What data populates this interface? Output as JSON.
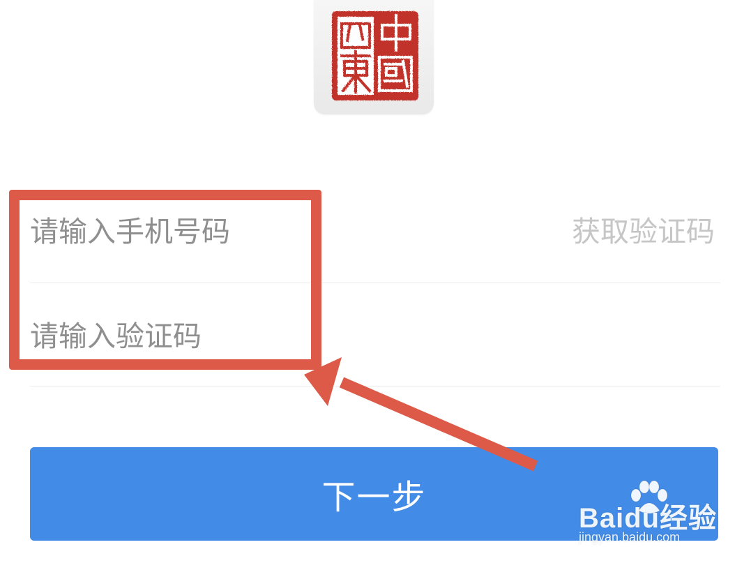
{
  "logo": {
    "seal_text": "中國四東",
    "seal_color": "#c0312b",
    "icon": "seal-logo-icon"
  },
  "form": {
    "phone_placeholder": "请输入手机号码",
    "phone_value": "",
    "get_code_label": "获取验证码",
    "code_placeholder": "请输入验证码",
    "code_value": ""
  },
  "primary_button": {
    "label": "下一步",
    "color": "#428be6"
  },
  "annotation": {
    "color": "#dc5a47"
  },
  "watermark": {
    "brand": "Baidu经验",
    "url": "jingyan.baidu.com"
  }
}
